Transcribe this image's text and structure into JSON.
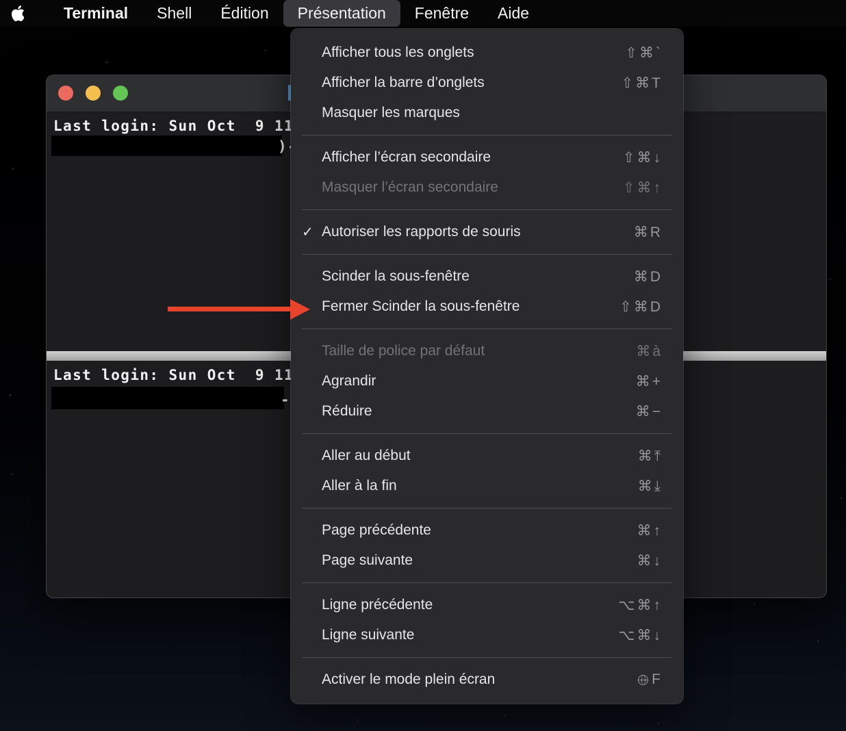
{
  "menu_bar": {
    "items": [
      {
        "label": "Terminal"
      },
      {
        "label": "Shell"
      },
      {
        "label": "Édition"
      },
      {
        "label": "Présentation"
      },
      {
        "label": "Fenêtre"
      },
      {
        "label": "Aide"
      }
    ],
    "active_item": "Présentation"
  },
  "terminal_window": {
    "panes": [
      {
        "last_login_line": "Last login: Sun Oct  9 11",
        "prompt_fragment": ")-"
      },
      {
        "last_login_line": "Last login: Sun Oct  9 11",
        "prompt_fragment": "-"
      }
    ]
  },
  "presentation_menu": {
    "groups": [
      {
        "items": [
          {
            "id": "show-all-tabs",
            "label": "Afficher tous les onglets",
            "shortcut": "⇧⌘`"
          },
          {
            "id": "show-tab-bar",
            "label": "Afficher la barre d’onglets",
            "shortcut": "⇧⌘T"
          },
          {
            "id": "hide-marks",
            "label": "Masquer les marques",
            "shortcut": ""
          }
        ]
      },
      {
        "items": [
          {
            "id": "show-secondary-screen",
            "label": "Afficher l’écran secondaire",
            "shortcut": "⇧⌘↓"
          },
          {
            "id": "hide-secondary-screen",
            "label": "Masquer l’écran secondaire",
            "shortcut": "⇧⌘↑",
            "disabled": true
          }
        ]
      },
      {
        "items": [
          {
            "id": "allow-mouse-reporting",
            "label": "Autoriser les rapports de souris",
            "shortcut": "⌘R",
            "check": "✓"
          }
        ]
      },
      {
        "items": [
          {
            "id": "split-pane",
            "label": "Scinder la sous-fenêtre",
            "shortcut": "⌘D"
          },
          {
            "id": "close-split-pane",
            "label": "Fermer Scinder la sous-fenêtre",
            "shortcut": "⇧⌘D"
          }
        ]
      },
      {
        "items": [
          {
            "id": "default-font-size",
            "label": "Taille de police par défaut",
            "shortcut": "⌘à",
            "disabled": true
          },
          {
            "id": "bigger",
            "label": "Agrandir",
            "shortcut": "⌘+"
          },
          {
            "id": "smaller",
            "label": "Réduire",
            "shortcut": "⌘−"
          }
        ]
      },
      {
        "items": [
          {
            "id": "scroll-to-top",
            "label": "Aller au début",
            "shortcut": "⌘⤒"
          },
          {
            "id": "scroll-to-bottom",
            "label": "Aller à la fin",
            "shortcut": "⌘⤓"
          }
        ]
      },
      {
        "items": [
          {
            "id": "page-up",
            "label": "Page précédente",
            "shortcut": "⌘↑"
          },
          {
            "id": "page-down",
            "label": "Page suivante",
            "shortcut": "⌘↓"
          }
        ]
      },
      {
        "items": [
          {
            "id": "line-up",
            "label": "Ligne précédente",
            "shortcut": "⌥⌘↑"
          },
          {
            "id": "line-down",
            "label": "Ligne suivante",
            "shortcut": "⌥⌘↓"
          }
        ]
      },
      {
        "items": [
          {
            "id": "enter-full-screen",
            "label": "Activer le mode plein écran",
            "shortcut": "🌐F"
          }
        ]
      }
    ]
  },
  "annotation": {
    "arrow_color": "#e8432b",
    "points_to": "Fermer Scinder la sous-fenêtre"
  },
  "colors": {
    "menu_background": "#2a2a2c",
    "menubar_active_background": "#39393d",
    "titlebar": "#2e2f31",
    "terminal_background": "#1d1d1f",
    "traffic_red": "#ee6a5f",
    "traffic_yellow": "#f5bf4f",
    "traffic_green": "#62c554",
    "split_divider": "#b5b5b5",
    "arrow_red": "#e8432b"
  }
}
